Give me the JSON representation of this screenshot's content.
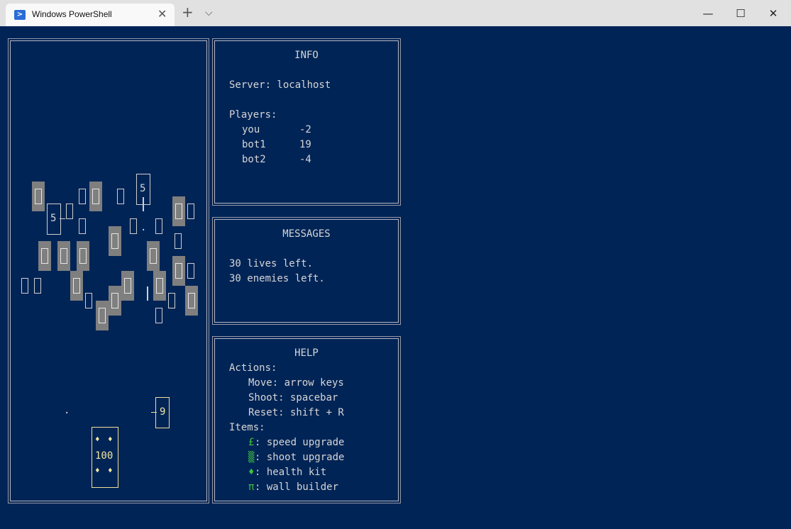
{
  "window": {
    "tab_title": "Windows PowerShell",
    "tab_icon": "powershell-icon",
    "close_tab": "✕",
    "new_tab": "+",
    "dropdown": "⌵",
    "minimize": "—",
    "maximize": "☐",
    "close": "✕"
  },
  "info": {
    "title": "INFO",
    "server_label": "Server: localhost",
    "players_label": "Players:",
    "players": [
      {
        "name": "you",
        "score": "-2"
      },
      {
        "name": "bot1",
        "score": "19"
      },
      {
        "name": "bot2",
        "score": "-4"
      }
    ]
  },
  "messages": {
    "title": "MESSAGES",
    "lines": [
      "30 lives left.",
      "30 enemies left."
    ]
  },
  "help": {
    "title": "HELP",
    "actions_label": "Actions:",
    "actions": [
      "Move: arrow keys",
      "Shoot: spacebar",
      "Reset: shift + R"
    ],
    "items_label": "Items:",
    "items": [
      {
        "symbol": "£",
        "text": ": speed upgrade"
      },
      {
        "symbol": "▒",
        "text": ": shoot upgrade"
      },
      {
        "symbol": "♦",
        "text": ": health kit"
      },
      {
        "symbol": "π",
        "text": ": wall builder"
      }
    ]
  },
  "game": {
    "tank_label_1": "5",
    "tank_label_2": "5",
    "enemy_health": "9",
    "player_health": "100",
    "player_marker": "♦"
  }
}
